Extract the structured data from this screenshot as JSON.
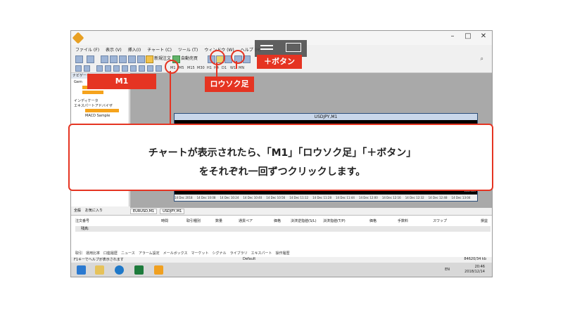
{
  "menu": [
    "ファイル (F)",
    "表示 (V)",
    "挿入(I)",
    "チャート (C)",
    "ツール (T)",
    "ウィンドウ (W)",
    "ヘルプ (H)"
  ],
  "toolbar": {
    "new_order": "新規注文",
    "auto_trade": "自動売買"
  },
  "timeframes": [
    "M1",
    "M5",
    "M15",
    "M30",
    "H1",
    "H4",
    "D1",
    "W1",
    "MN"
  ],
  "navigator": {
    "title": "ナビゲーター",
    "root": "Gem",
    "indicators": "インディケータ",
    "expert_advisors": "エキスパートアドバイザ",
    "macd": "MACD Sample",
    "tabs": [
      "全般",
      "お気に入り"
    ]
  },
  "chart": {
    "window_title": "USDJPY,M1",
    "price": "113.455",
    "axis_labels": [
      "14 Dec 2018",
      "14 Dec 10:08",
      "14 Dec 10:24",
      "14 Dec 10:40",
      "14 Dec 10:56",
      "14 Dec 11:12",
      "14 Dec 11:28",
      "14 Dec 11:44",
      "14 Dec 12:00",
      "14 Dec 12:16",
      "14 Dec 12:32",
      "14 Dec 12:48",
      "14 Dec 13:04"
    ],
    "tabs": [
      "EURUSD,M1",
      "USDJPY,M1"
    ]
  },
  "terminal": {
    "columns": [
      "注文番号",
      "時間",
      "取引種別",
      "数量",
      "通貨ペア",
      "価格",
      "決済逆指値(S/L)",
      "決済指値(T/P)",
      "価格",
      "手数料",
      "スワップ",
      "損益"
    ],
    "balance_row": "残高:",
    "tabs": [
      "取引",
      "運用比率",
      "口座履歴",
      "ニュース",
      "アラーム設定",
      "メールボックス",
      "マーケット",
      "シグナル",
      "ライブラリ",
      "エキスパート",
      "操作履歴"
    ]
  },
  "status": {
    "help": "F1キーでヘルプが表示されます",
    "profile": "Default",
    "traffic": "84620/34 kb"
  },
  "taskbar": {
    "clock_time": "20:46",
    "clock_date": "2018/12/14",
    "lang": "EN"
  },
  "annotations": {
    "m1_label": "M1",
    "candle_label": "ロウソク足",
    "plus_label": "＋ボタン",
    "instruction_line1": "チャートが表示されたら、「M1」「ロウソク足」「＋ボタン」",
    "instruction_line2": "をそれぞれ一回ずつクリックします。"
  },
  "colors": {
    "accent_red": "#e53422",
    "highlight_orange": "#f5a31c",
    "chart_bg": "#000000"
  }
}
